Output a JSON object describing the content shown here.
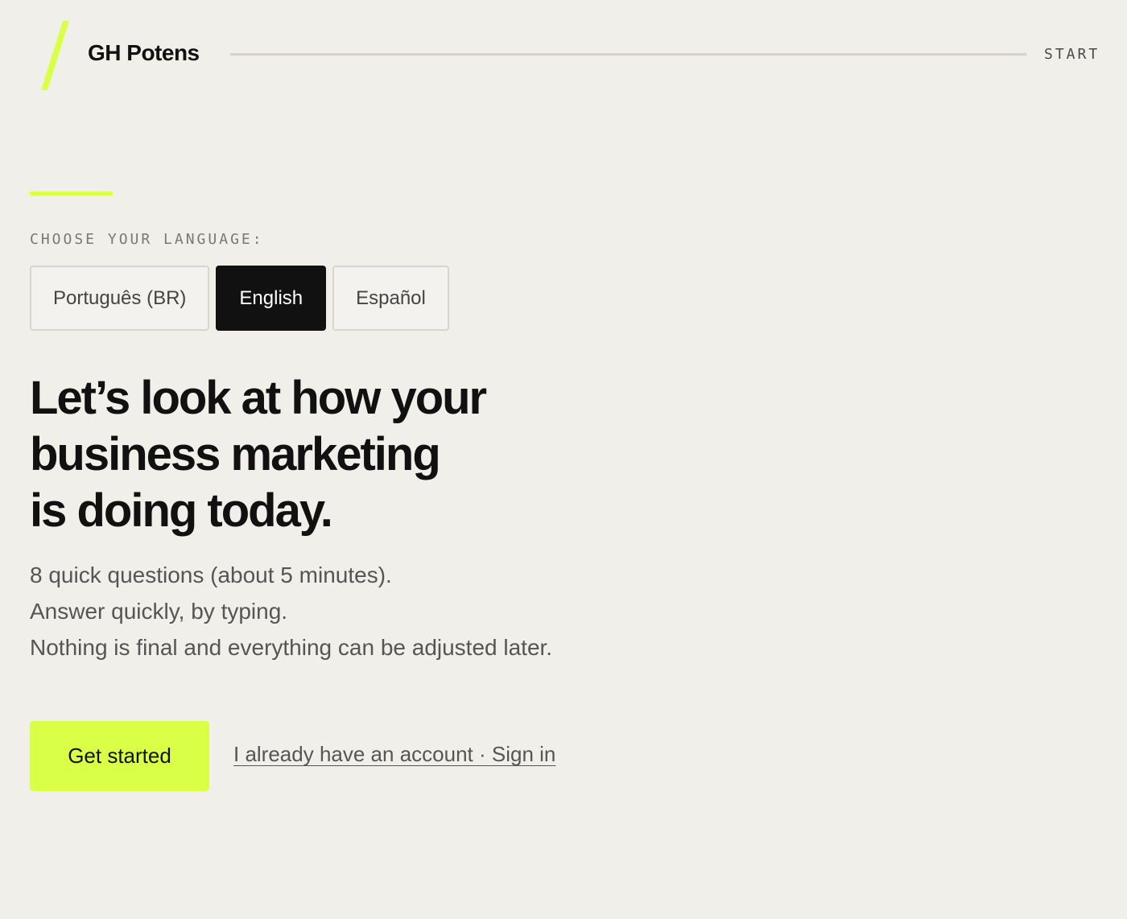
{
  "header": {
    "brand": "GH Potens",
    "step_label": "START"
  },
  "language": {
    "label": "CHOOSE YOUR LANGUAGE:",
    "options": [
      "Português (BR)",
      "English",
      "Español"
    ],
    "selected": "English"
  },
  "hero": {
    "headline_lines": [
      "Let’s look at how your",
      "business marketing",
      "is doing today."
    ],
    "subtext_lines": [
      "8 quick questions (about 5 minutes).",
      "Answer quickly, by typing.",
      "Nothing is final and everything can be adjusted later."
    ]
  },
  "actions": {
    "primary_label": "Get started",
    "secondary_label": "I already have an account · Sign in"
  },
  "colors": {
    "background": "#f1efe9",
    "accent": "#d9ff47",
    "dark": "#111111"
  },
  "icons": {
    "logo": "slash-logo-icon"
  }
}
